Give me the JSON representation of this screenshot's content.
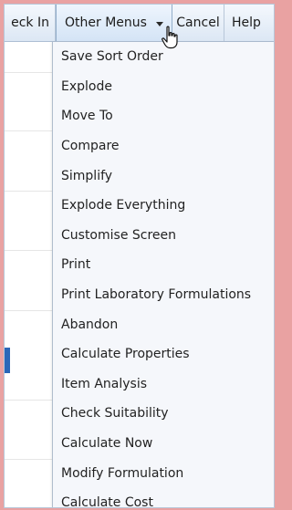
{
  "toolbar": {
    "check_in": "eck In",
    "other_menus": "Other Menus",
    "cancel": "Cancel",
    "help": "Help"
  },
  "menu": {
    "items": [
      "Save Sort Order",
      "Explode",
      "Move To",
      "Compare",
      "Simplify",
      "Explode Everything",
      "Customise Screen",
      "Print",
      "Print Laboratory Formulations",
      "Abandon",
      "Calculate Properties",
      "Item Analysis",
      "Check Suitability",
      "Calculate Now",
      "Modify Formulation",
      "Calculate Cost"
    ]
  },
  "colors": {
    "page_background": "#e9a2a2",
    "toolbar_bg": "#dce7f4",
    "menu_bg": "#f5f7fb",
    "selection_accent": "#2a67b8"
  },
  "icons": {
    "cursor": "hand-pointer-icon",
    "dropdown": "caret-down-icon"
  }
}
